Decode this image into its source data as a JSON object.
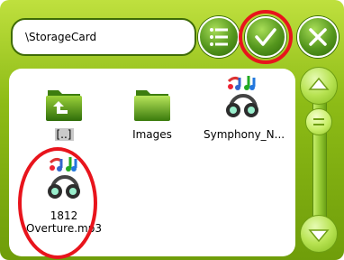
{
  "toolbar": {
    "path_value": "\\StorageCard",
    "menu_icon": "list-menu-icon",
    "ok_icon": "checkmark-icon",
    "close_icon": "close-x-icon"
  },
  "files": [
    {
      "label": "[..]",
      "kind": "parent-folder",
      "icon": "folder-up-icon",
      "selected": true
    },
    {
      "label": "Images",
      "kind": "folder",
      "icon": "folder-icon",
      "selected": false
    },
    {
      "label": "Symphony_N...",
      "kind": "audio",
      "icon": "music-headphones-icon",
      "selected": false
    },
    {
      "label_line1": "1812",
      "label_line2": "Overture.mp3",
      "kind": "audio",
      "icon": "music-headphones-icon",
      "selected": false
    }
  ],
  "scrollbar": {
    "up_icon": "scroll-up-arrow-icon",
    "down_icon": "scroll-down-arrow-icon",
    "thumb_icon": "scroll-thumb-icon"
  },
  "colors": {
    "frame_green": "#8dbb16",
    "highlight_red": "#e8141c",
    "selection_gray": "#c9c9c9"
  }
}
